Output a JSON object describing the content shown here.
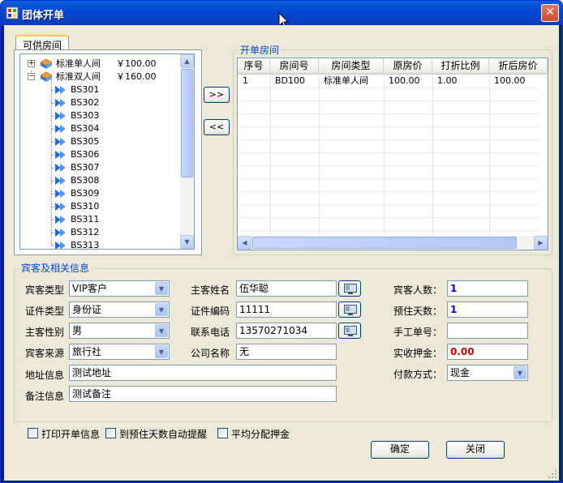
{
  "window": {
    "title": "团体开单"
  },
  "left_panel": {
    "tab_label": "可供房间",
    "room_types": [
      {
        "label": "标准单人间",
        "price": "￥100.00",
        "expander": "+"
      },
      {
        "label": "标准双人间",
        "price": "￥160.00",
        "expander": "−"
      }
    ],
    "rooms": [
      "BS301",
      "BS302",
      "BS303",
      "BS304",
      "BS305",
      "BS306",
      "BS307",
      "BS308",
      "BS309",
      "BS310",
      "BS311",
      "BS312",
      "BS313"
    ]
  },
  "transfer": {
    "add_label": ">>",
    "remove_label": "<<"
  },
  "opened_rooms": {
    "title": "开单房间",
    "columns": [
      "序号",
      "房间号",
      "房间类型",
      "原房价",
      "打折比例",
      "折后房价"
    ],
    "rows": [
      [
        "1",
        "BD100",
        "标准单人间",
        "100.00",
        "1.00",
        "100.00"
      ]
    ]
  },
  "guest_info": {
    "title": "宾客及相关信息",
    "guest_type": {
      "label": "宾客类型",
      "value": "VIP客户"
    },
    "id_type": {
      "label": "证件类型",
      "value": "身份证"
    },
    "gender": {
      "label": "主客性别",
      "value": "男"
    },
    "source": {
      "label": "宾客来源",
      "value": "旅行社"
    },
    "address": {
      "label": "地址信息",
      "value": "测试地址"
    },
    "remark": {
      "label": "备注信息",
      "value": "测试备注"
    },
    "main_guest_name": {
      "label": "主客姓名",
      "value": "伍华聪"
    },
    "id_number": {
      "label": "证件编码",
      "value": "11111"
    },
    "phone": {
      "label": "联系电话",
      "value": "13570271034"
    },
    "company": {
      "label": "公司名称",
      "value": "无"
    },
    "guest_count": {
      "label": "宾客人数：",
      "value": "1"
    },
    "stay_days": {
      "label": "预住天数：",
      "value": "1"
    },
    "manual_no": {
      "label": "手工单号：",
      "value": ""
    },
    "deposit": {
      "label": "实收押金：",
      "value": "0.00"
    },
    "payment": {
      "label": "付款方式：",
      "value": "现金"
    }
  },
  "options": {
    "print_info": "打印开单信息",
    "auto_remind": "到预住天数自动提醒",
    "split_deposit": "平均分配押金"
  },
  "buttons": {
    "ok": "确定",
    "close": "关闭"
  },
  "colors": {
    "title_bar": "#0046d5",
    "group_title": "#0046d5",
    "deposit_value": "#cc0000",
    "count_value": "#0000cc"
  }
}
